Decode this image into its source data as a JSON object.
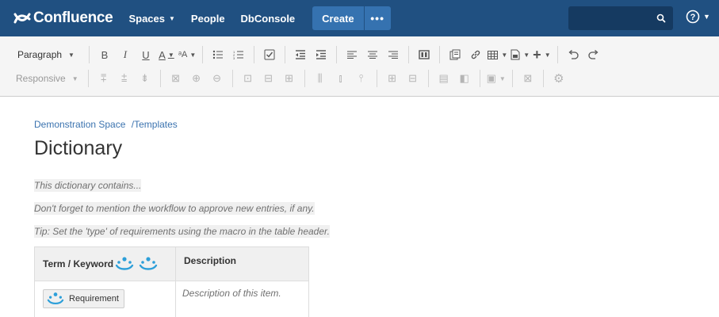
{
  "topnav": {
    "logo_text": "Confluence",
    "items": [
      {
        "label": "Spaces",
        "has_caret": true
      },
      {
        "label": "People",
        "has_caret": false
      },
      {
        "label": "DbConsole",
        "has_caret": false
      }
    ],
    "create_label": "Create",
    "more_label": "•••",
    "search_placeholder": ""
  },
  "toolbar": {
    "row1": {
      "paragraph_label": "Paragraph",
      "buttons": [
        "bold-icon",
        "italic-icon",
        "underline-icon",
        "text-color-icon",
        "text-format-icon",
        "bullet-list-icon",
        "numbered-list-icon",
        "task-list-icon",
        "outdent-icon",
        "indent-icon",
        "align-left-icon",
        "align-center-icon",
        "align-right-icon",
        "page-layout-icon",
        "insert-file-icon",
        "link-icon",
        "table-icon",
        "insert-template-icon",
        "insert-more-icon",
        "undo-icon",
        "redo-icon"
      ]
    },
    "row2": {
      "responsive_label": "Responsive"
    }
  },
  "content": {
    "breadcrumb": {
      "space": "Demonstration Space",
      "separator": "/",
      "page": "Templates"
    },
    "title": "Dictionary",
    "paragraphs": [
      "This dictionary contains...",
      "Don't forget to mention the workflow to approve new entries, if any.",
      "Tip: Set the 'type' of requirements using the macro in the table header."
    ],
    "table": {
      "headers": [
        "Term / Keyword",
        "Description"
      ],
      "rows": [
        {
          "term": "Requirement",
          "description": "Description of this item."
        }
      ]
    }
  },
  "colors": {
    "nav_bg": "#205081",
    "create_bg": "#3572b0",
    "link": "#3b73af",
    "macro_icon": "#2d9fd9"
  }
}
